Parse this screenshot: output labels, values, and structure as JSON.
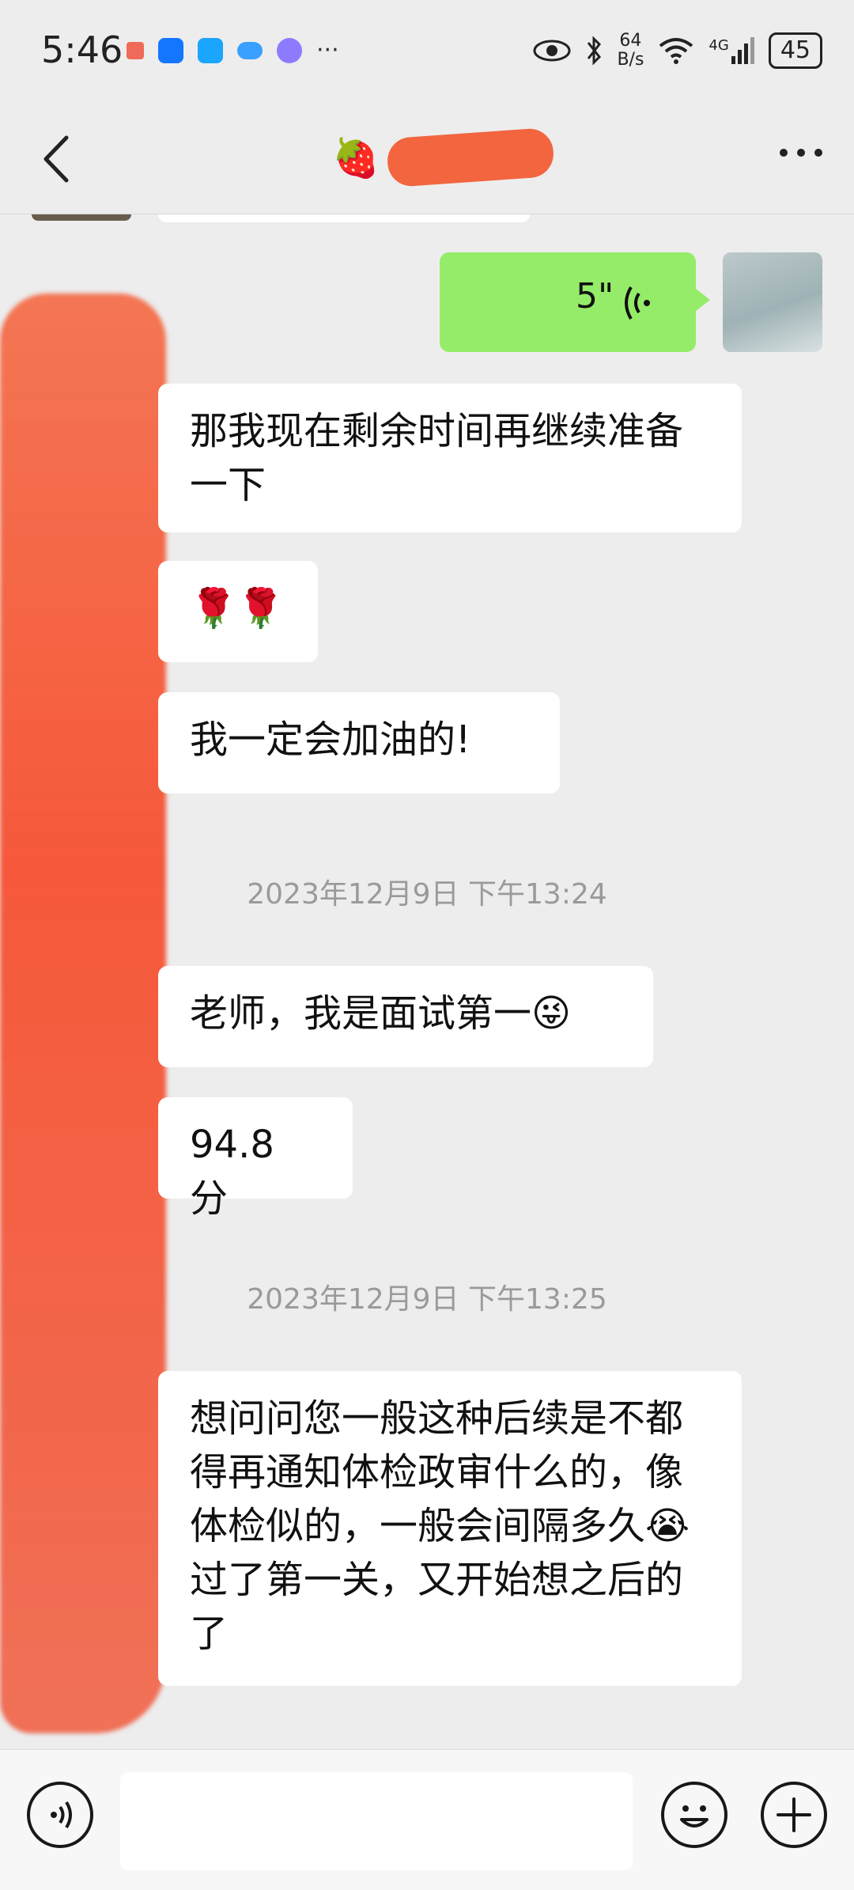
{
  "status_bar": {
    "time": "5:46",
    "network_speed_value": "64",
    "network_speed_unit": "B/s",
    "mobile_network": "4G",
    "battery_level": "45",
    "more_indicator": "···",
    "app_icon_colors": [
      "#f06a5a",
      "#1476ff",
      "#1aa5ff",
      "#3aa0ff",
      "#8d7bff"
    ]
  },
  "nav": {
    "title_emoji": "🍓",
    "back_icon": "chevron-left-icon",
    "more_icon": "more-dots-icon"
  },
  "messages": [
    {
      "type": "voice",
      "direction": "outgoing",
      "duration": "5\""
    },
    {
      "type": "text",
      "direction": "incoming",
      "text": "那我现在剩余时间再继续准备一下"
    },
    {
      "type": "text",
      "direction": "incoming",
      "text": "🌹🌹"
    },
    {
      "type": "text",
      "direction": "incoming",
      "text": "我一定会加油的!"
    },
    {
      "type": "timestamp",
      "text": "2023年12月9日 下午13:24"
    },
    {
      "type": "text",
      "direction": "incoming",
      "text": "老师，我是面试第一😜"
    },
    {
      "type": "text",
      "direction": "incoming",
      "text": "94.8 分"
    },
    {
      "type": "timestamp",
      "text": "2023年12月9日 下午13:25"
    },
    {
      "type": "text",
      "direction": "incoming",
      "text": "想问问您一般这种后续是不都得再通知体检政审什么的，像体检似的，一般会间隔多久😭过了第一关，又开始想之后的了"
    }
  ],
  "colors": {
    "outgoing_bubble": "#95ec69",
    "incoming_bubble": "#ffffff",
    "background": "#ededed",
    "redaction": "#f2653f"
  }
}
